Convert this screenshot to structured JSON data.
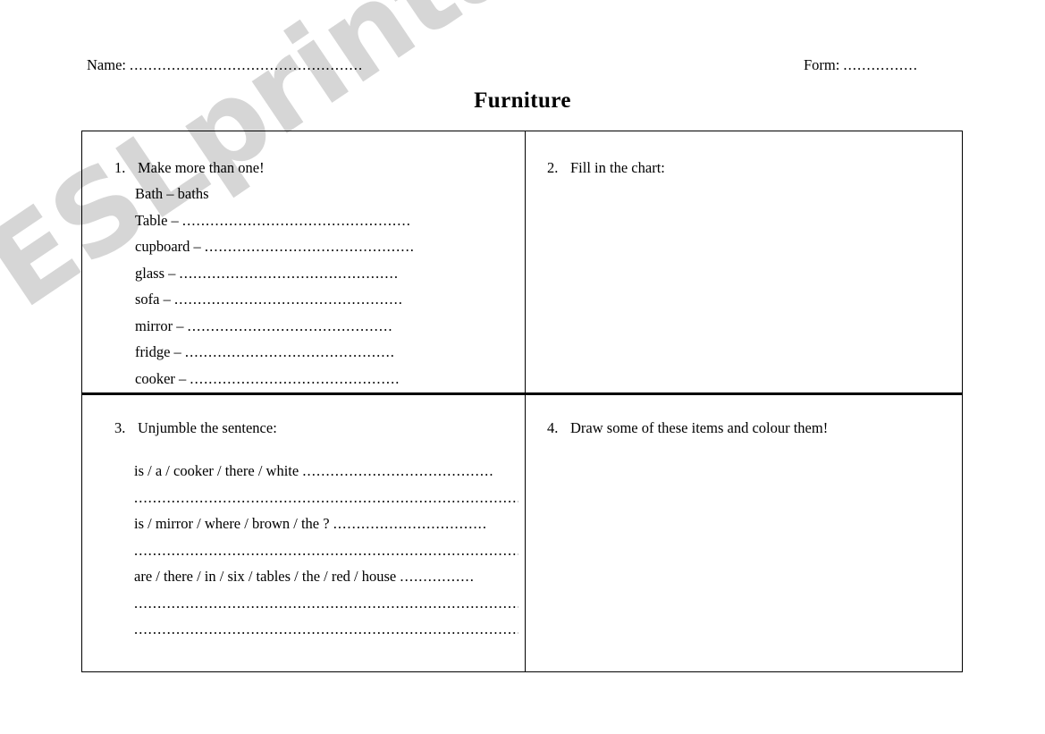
{
  "header": {
    "name_label": "Name:",
    "name_dots": "..................................................",
    "form_label": "Form:",
    "form_dots": "................"
  },
  "title": "Furniture",
  "watermark": "ESLprintables.com",
  "exercises": {
    "ex1": {
      "number": "1.",
      "heading": "Make more than one!",
      "example": {
        "term": "Bath",
        "dash": "–",
        "answer": "baths"
      },
      "items": [
        {
          "term": "Table",
          "dash": "–",
          "dots": "................................................."
        },
        {
          "term": "cupboard",
          "dash": "–",
          "dots": "............................................."
        },
        {
          "term": "glass",
          "dash": "–",
          "dots": "..............................................."
        },
        {
          "term": "sofa",
          "dash": "–",
          "dots": "................................................."
        },
        {
          "term": "mirror",
          "dash": "–",
          "dots": "............................................"
        },
        {
          "term": "fridge",
          "dash": "–",
          "dots": "............................................."
        },
        {
          "term": "cooker",
          "dash": "–",
          "dots": "............................................."
        }
      ]
    },
    "ex2": {
      "number": "2.",
      "heading": "Fill in the chart:"
    },
    "ex3": {
      "number": "3.",
      "heading": "Unjumble the sentence:",
      "lines": [
        {
          "type": "sentence",
          "text": "is / a / cooker / there / white",
          "dots": "........................................."
        },
        {
          "type": "blank",
          "dots": "............................................................................................."
        },
        {
          "type": "sentence",
          "text": "is / mirror / where / brown / the ?",
          "dots": "................................."
        },
        {
          "type": "blank",
          "dots": "............................................................................................."
        },
        {
          "type": "sentence",
          "text": "are / there / in / six / tables / the / red / house",
          "dots": "................"
        },
        {
          "type": "blank",
          "dots": "............................................................................................."
        },
        {
          "type": "blank",
          "dots": "............................................................................................."
        }
      ]
    },
    "ex4": {
      "number": "4.",
      "heading": "Draw some of these items and colour them!"
    }
  }
}
